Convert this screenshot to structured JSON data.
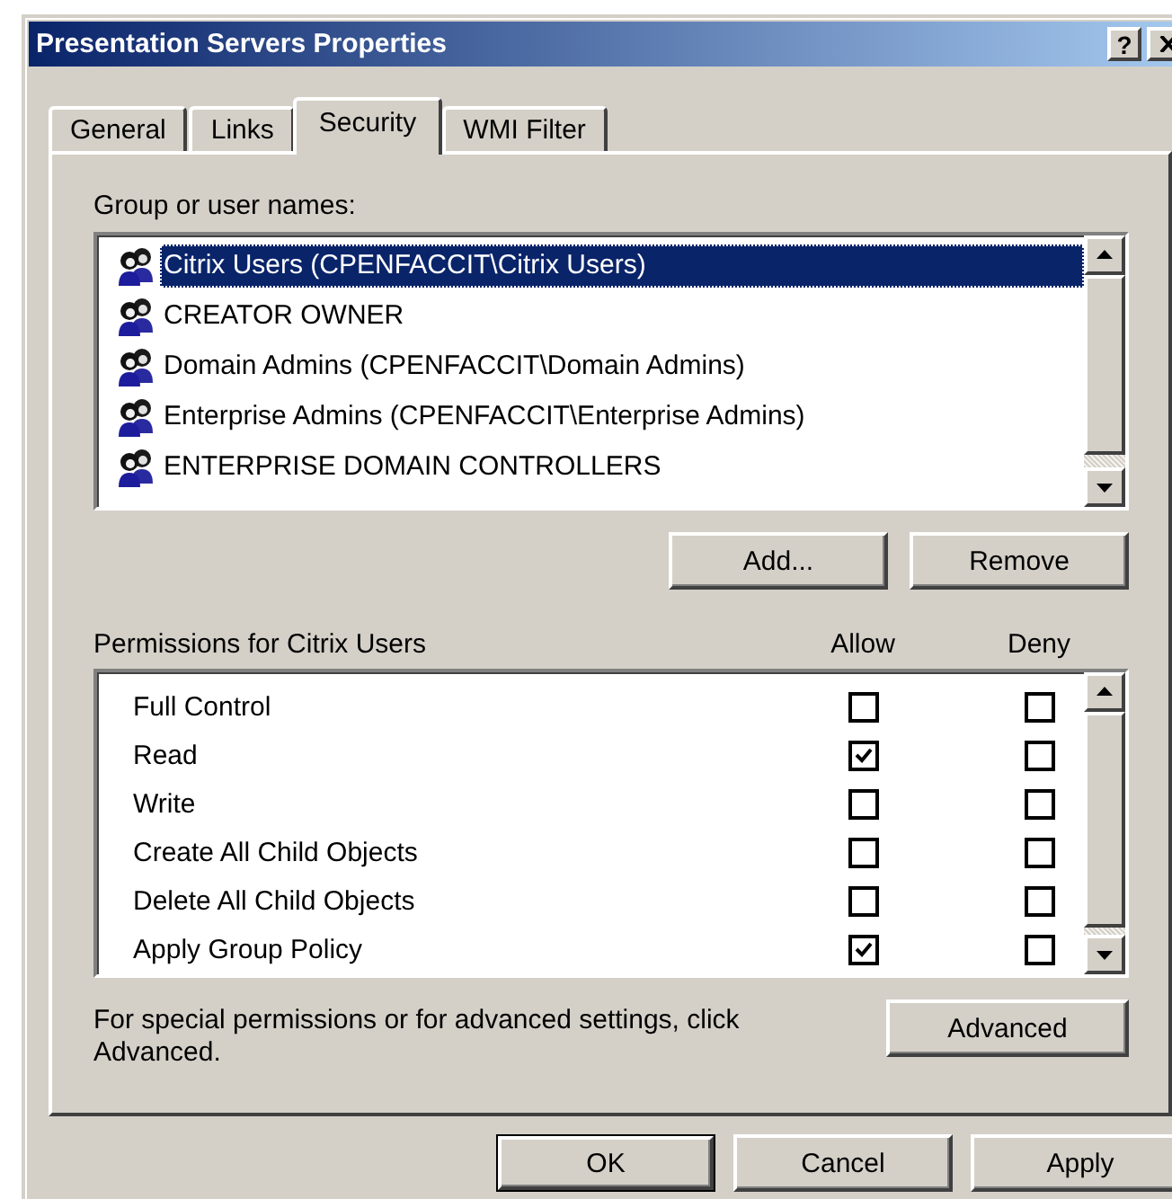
{
  "window": {
    "title": "Presentation Servers Properties",
    "help_button": "?"
  },
  "tabs": [
    {
      "label": "General",
      "selected": false
    },
    {
      "label": "Links",
      "selected": false
    },
    {
      "label": "Security",
      "selected": true
    },
    {
      "label": "WMI Filter",
      "selected": false
    }
  ],
  "group_list": {
    "label": "Group or user names:",
    "items": [
      {
        "name": "Citrix Users (CPENFACCIT\\Citrix Users)",
        "selected": true
      },
      {
        "name": "CREATOR OWNER",
        "selected": false
      },
      {
        "name": "Domain Admins (CPENFACCIT\\Domain Admins)",
        "selected": false
      },
      {
        "name": "Enterprise Admins (CPENFACCIT\\Enterprise Admins)",
        "selected": false
      },
      {
        "name": "ENTERPRISE DOMAIN CONTROLLERS",
        "selected": false
      }
    ]
  },
  "group_buttons": [
    "Add...",
    "Remove"
  ],
  "permissions": {
    "label": "Permissions for Citrix Users",
    "columns": [
      "Allow",
      "Deny"
    ],
    "rows": [
      {
        "name": "Full Control",
        "allow": false,
        "deny": false
      },
      {
        "name": "Read",
        "allow": true,
        "deny": false
      },
      {
        "name": "Write",
        "allow": false,
        "deny": false
      },
      {
        "name": "Create All Child Objects",
        "allow": false,
        "deny": false
      },
      {
        "name": "Delete All Child Objects",
        "allow": false,
        "deny": false
      },
      {
        "name": "Apply Group Policy",
        "allow": true,
        "deny": false
      }
    ]
  },
  "advanced_note": "For special permissions or for advanced settings, click Advanced.",
  "advanced_button": "Advanced",
  "dialog_buttons": [
    {
      "label": "OK",
      "default": true
    },
    {
      "label": "Cancel",
      "default": false
    },
    {
      "label": "Apply",
      "default": false
    }
  ]
}
